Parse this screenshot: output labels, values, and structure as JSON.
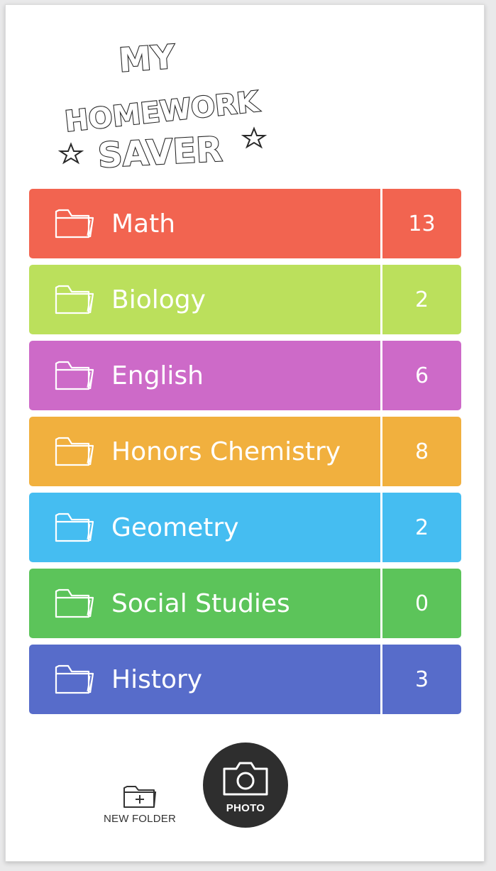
{
  "logo": {
    "line1": "MY",
    "line2": "HOMEWORK",
    "line3": "SAVER"
  },
  "folders": [
    {
      "name": "Math",
      "count": "13",
      "color": "#f26450"
    },
    {
      "name": "Biology",
      "count": "2",
      "color": "#bbe05c"
    },
    {
      "name": "English",
      "count": "6",
      "color": "#cd6ac8"
    },
    {
      "name": "Honors Chemistry",
      "count": "8",
      "color": "#f1b03e"
    },
    {
      "name": "Geometry",
      "count": "2",
      "color": "#45bdf1"
    },
    {
      "name": "Social Studies",
      "count": "0",
      "color": "#5cc45a"
    },
    {
      "name": "History",
      "count": "3",
      "color": "#576cca"
    }
  ],
  "toolbar": {
    "new_folder_label": "NEW FOLDER",
    "photo_label": "PHOTO"
  },
  "icons": {
    "folder": "folder-icon",
    "new_folder": "folder-plus-icon",
    "camera": "camera-icon",
    "star": "star-icon"
  }
}
